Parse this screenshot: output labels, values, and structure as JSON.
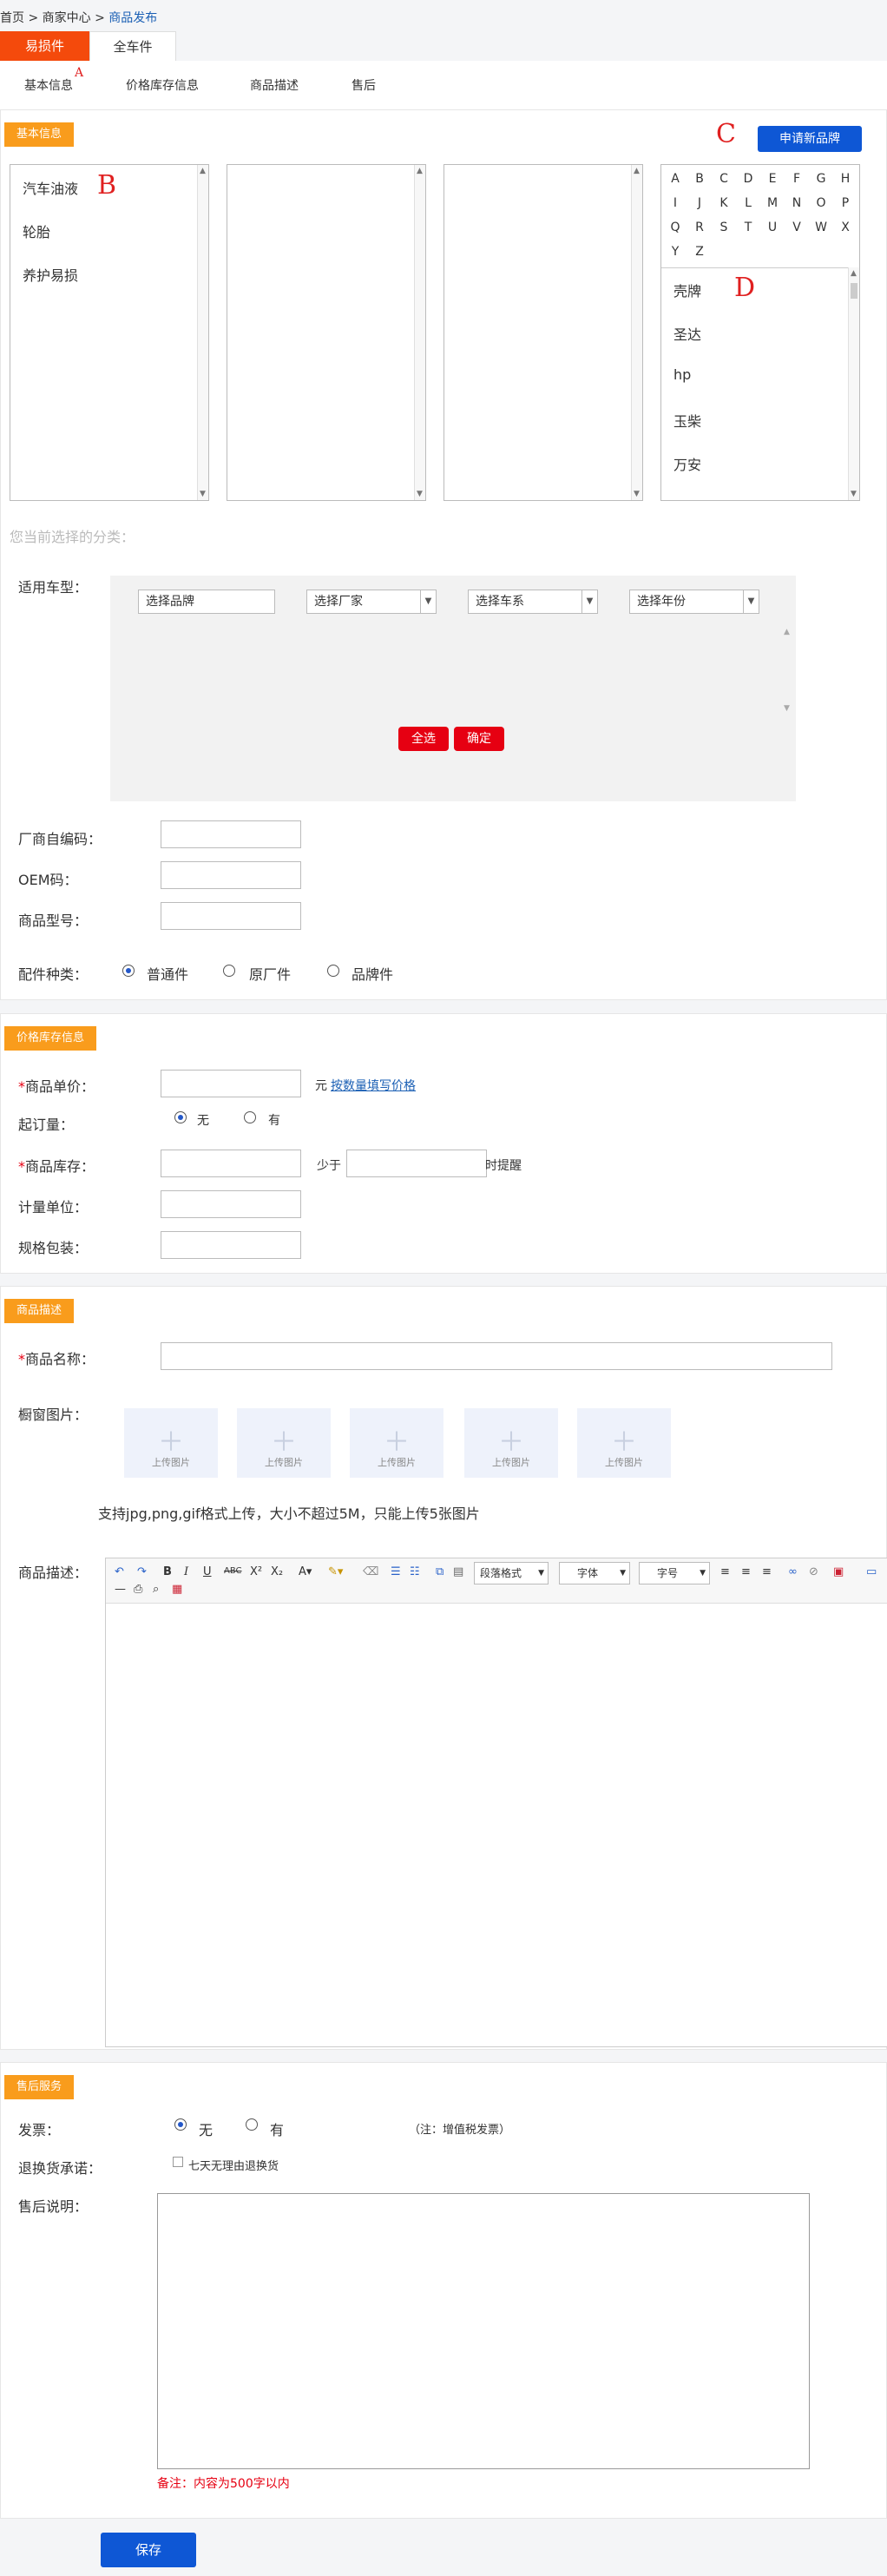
{
  "breadcrumb": {
    "home": "首页",
    "sep1": ">",
    "center": "商家中心",
    "sep2": ">",
    "current": "商品发布"
  },
  "tabs": [
    {
      "label": "易损件"
    },
    {
      "label": "全车件"
    }
  ],
  "subnav": [
    "基本信息",
    "价格库存信息",
    "商品描述",
    "售后"
  ],
  "annotations": {
    "a": "A",
    "b": "B",
    "c": "C",
    "d": "D"
  },
  "basic": {
    "badge": "基本信息",
    "apply_brand": "申请新品牌",
    "categories": [
      "汽车油液",
      "轮胎",
      "养护易损"
    ],
    "letters": [
      "A",
      "B",
      "C",
      "D",
      "E",
      "F",
      "G",
      "H",
      "I",
      "J",
      "K",
      "L",
      "M",
      "N",
      "O",
      "P",
      "Q",
      "R",
      "S",
      "T",
      "U",
      "V",
      "W",
      "X",
      "Y",
      "Z"
    ],
    "brands": [
      "壳牌",
      "圣达",
      "hp",
      "玉柴",
      "万安"
    ],
    "current_category": "您当前选择的分类：",
    "vehicle_label": "适用车型：",
    "vehicle": {
      "brand": "选择品牌",
      "maker": "选择厂家",
      "series": "选择车系",
      "year": "选择年份",
      "select_all": "全选",
      "confirm": "确定"
    },
    "code_label": "厂商自编码：",
    "oem_label": "OEM码：",
    "model_label": "商品型号：",
    "part_type_label": "配件种类：",
    "part_types": [
      "普通件",
      "原厂件",
      "品牌件"
    ]
  },
  "price": {
    "badge": "价格库存信息",
    "req": "*",
    "unit_price_label": "商品单价：",
    "yuan": "元",
    "qty_price_link": "按数量填写价格",
    "min_order_label": "起订量：",
    "min_order_opts": [
      "无",
      "有"
    ],
    "stock_label": "商品库存：",
    "less_than": "少于",
    "alert": "时提醒",
    "unit_label": "计量单位：",
    "pack_label": "规格包装："
  },
  "desc": {
    "badge": "商品描述",
    "req": "*",
    "name_label": "商品名称：",
    "window_label": "橱窗图片：",
    "upload": "上传图片",
    "upload_hint": "支持jpg,png,gif格式上传，大小不超过5M，只能上传5张图片",
    "desc_label": "商品描述：",
    "toolbar": {
      "para": "段落格式",
      "font": "字体",
      "size": "字号"
    }
  },
  "after": {
    "badge": "售后服务",
    "invoice_label": "发票：",
    "invoice_opts": [
      "无",
      "有"
    ],
    "invoice_note": "（注：增值税发票）",
    "return_label": "退换货承诺：",
    "return_opt": "七天无理由退换货",
    "explain_label": "售后说明：",
    "note": "备注：内容为500字以内"
  },
  "save": "保存"
}
